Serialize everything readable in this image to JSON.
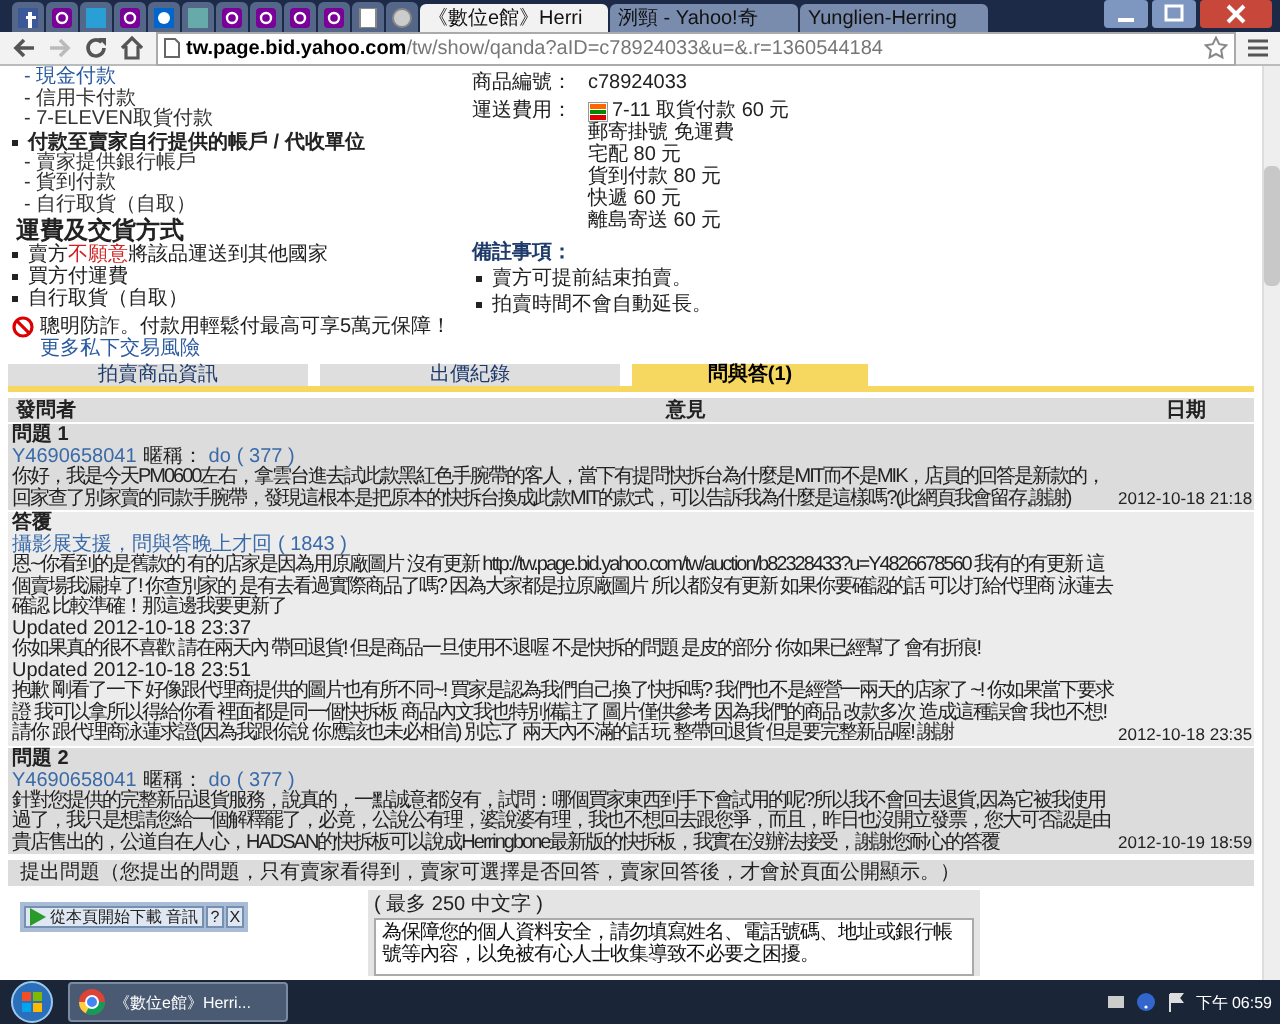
{
  "browser": {
    "tabs": [
      {
        "title": "《數位e館》Herri",
        "selected": true
      },
      {
        "title": "洌頸 - Yahoo!奇",
        "selected": false
      },
      {
        "title": "Yunglien-Herring",
        "selected": false
      }
    ],
    "address": {
      "host": "tw.page.bid.yahoo.com",
      "path": "/tw/show/qanda?aID=c78924033&u=&.r=1360544184"
    }
  },
  "payment": [
    {
      "kind": "sub",
      "text": "- 現金付款"
    },
    {
      "kind": "sub",
      "text": "- 信用卡付款"
    },
    {
      "kind": "sub",
      "text": "- 7-ELEVEN取貨付款"
    },
    {
      "kind": "main",
      "text": "付款至賣家自行提供的帳戶 / 代收單位"
    },
    {
      "kind": "sub",
      "text": "- 賣家提供銀行帳戶"
    },
    {
      "kind": "sub",
      "text": "- 貨到付款"
    },
    {
      "kind": "sub",
      "text": "- 自行取貨（自取）"
    }
  ],
  "delivery": {
    "heading": "運費及交貨方式",
    "items": [
      {
        "parts": [
          {
            "text": "賣方",
            "highlight": false
          },
          {
            "text": "不願意",
            "highlight": true
          },
          {
            "text": "將該品運送到其他國家",
            "highlight": false
          }
        ]
      },
      {
        "parts": [
          {
            "text": "買方付運費",
            "highlight": false
          }
        ]
      },
      {
        "parts": [
          {
            "text": "自行取貨（自取）",
            "highlight": false
          }
        ]
      }
    ]
  },
  "item_info": {
    "id_label": "商品編號：",
    "id": "c78924033",
    "shipping_label": "運送費用：",
    "shipping": [
      "7-11 取貨付款 60 元",
      "郵寄掛號 免運費",
      "宅配 80 元",
      "貨到付款 80 元",
      "快遞 60 元",
      "離島寄送 60 元"
    ]
  },
  "notes": {
    "heading": "備註事項：",
    "items": [
      "賣方可提前結束拍賣。",
      "拍賣時間不會自動延長。"
    ]
  },
  "warning": {
    "text": "聰明防詐。付款用輕鬆付最高可享5萬元保障！",
    "link": "更多私下交易風險"
  },
  "page_tabs": [
    {
      "label": "拍賣商品資訊",
      "selected": false
    },
    {
      "label": "出價紀錄",
      "selected": false
    },
    {
      "label": "問與答(1)",
      "selected": true
    }
  ],
  "qa": {
    "columns": [
      "發問者",
      "意見",
      "日期"
    ],
    "threads": [
      {
        "question": {
          "title": "問題 1",
          "user": "Y4690658041",
          "nick_label": "暱稱：",
          "nick": "do",
          "score": "( 377 )",
          "text": "你好，我是今天PM0600左右，拿雲台進去試此款黑紅色手腕帶的客人，當下有提問快拆台為什麼是MIT而不是MIK，店員的回答是新款的，回家查了別家賣的同款手腕帶，發現這根本是把原本的快拆台換成此款MIT的款式，可以告訴我為什麼是這樣嗎?(此網頁我會留存,謝謝)",
          "date": "2012-10-18 21:18"
        },
        "answer": {
          "title": "答覆",
          "seller": "攝影展支援，問與答晚上才回",
          "score": "( 1843 )",
          "lines": [
            {
              "kind": "text",
              "text": "恩~你看到的是舊款的 有的店家是因為用原廠圖片 沒有更新 http://tw.page.bid.yahoo.com/tw/auction/b82328433?u=Y4826678560 我有的有更新 這個賣場我漏掉了! 你查別家的 是有去看過實際商品了嗎? 因為大家都是拉原廠圖片 所以都沒有更新 如果你要確認的話 可以打給代理商 泳蓮去確認 比較準確！那這邊我要更新了"
            },
            {
              "kind": "updated",
              "text": "Updated 2012-10-18 23:37"
            },
            {
              "kind": "text",
              "text": "你如果真的很不喜歡 請在兩天內 帶回退貨! 但是商品一旦使用不退喔 不是快拆的問題 是皮的部分 你如果已經幫了 會有折痕!"
            },
            {
              "kind": "updated",
              "text": "Updated 2012-10-18 23:51"
            },
            {
              "kind": "text",
              "text": "抱歉 剛看了一下 好像跟代理商提供的圖片也有所不同~! 買家是認為我們自己換了快拆嗎? 我們也不是經營一兩天的店家了 ~! 你如果當下要求證 我可以拿所以得給你看 裡面都是同一個快拆板 商品內文我也特別備註了 圖片僅供參考 因為我們的商品 改款多次 造成這種誤會 我也不想! 請你 跟代理商泳蓮求證(因為我跟你說 你應該也未必相信) 別忘了 兩天內不滿的話 玩 整帶回退貨 但是要完整新品喔! 謝謝"
            }
          ],
          "date": "2012-10-18 23:35"
        }
      },
      {
        "question": {
          "title": "問題 2",
          "user": "Y4690658041",
          "nick_label": "暱稱：",
          "nick": "do",
          "score": "( 377 )",
          "text": "針對您提供的完整新品退貨服務，說真的，一點誠意都沒有，試問：哪個買家東西到手下會試用的呢?所以我不會回去退貨,因為它被我使用過了，我只是想請您給一個解釋罷了，必竟，公說公有理，婆說婆有理，我也不想回去跟您爭，而且，昨日也沒開立發票，您大可否認是由貴店售出的，公道自在人心，HADSAN的快拆板可以說成Herringbone最新版的快拆板，我實在沒辦法接受，謝謝您耐心的答覆",
          "date": "2012-10-19 18:59"
        }
      }
    ]
  },
  "ask": {
    "title": "提出問題（您提出的問題，只有賣家看得到，賣家可選擇是否回答，賣家回答後，才會於頁面公開顯示。）",
    "limit": "( 最多 250 中文字 )",
    "placeholder": "為保障您的個人資料安全，請勿填寫姓名、電話號碼、地址或銀行帳號等內容，以免被有心人士收集導致不必要之困擾。"
  },
  "download_bar": {
    "label": "從本頁開始下載 音訊",
    "help": "?",
    "close": "X"
  },
  "taskbar": {
    "task": "《數位e館》Herri...",
    "clock": "下午 06:59"
  }
}
